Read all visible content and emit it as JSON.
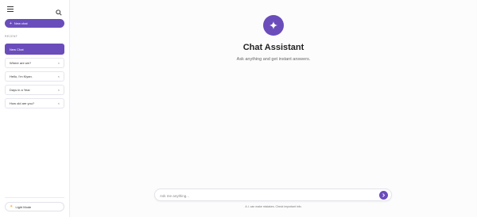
{
  "sidebar": {
    "new_chat_label": "New chat",
    "recent_label": "RECENT",
    "items": [
      {
        "label": "New Chat",
        "active": true
      },
      {
        "label": "Where are we?",
        "active": false
      },
      {
        "label": "Hello, I'm Kiyan.",
        "active": false
      },
      {
        "label": "Days in a Year",
        "active": false
      },
      {
        "label": "How old are you?",
        "active": false
      }
    ],
    "light_mode_label": "Light Mode"
  },
  "main": {
    "title": "Chat Assistant",
    "subtitle": "Ask anything and get instant answers.",
    "input_placeholder": "Ask me anything...",
    "disclaimer": "A.I. can make mistakes. Check important info."
  },
  "colors": {
    "accent": "#6a4dbb",
    "sun": "#f5a623"
  },
  "icons": {
    "menu": "menu-icon",
    "search": "search-icon",
    "sparkle": "sparkle-icon",
    "send": "send-icon",
    "sun": "sun-icon",
    "close": "close-icon"
  }
}
